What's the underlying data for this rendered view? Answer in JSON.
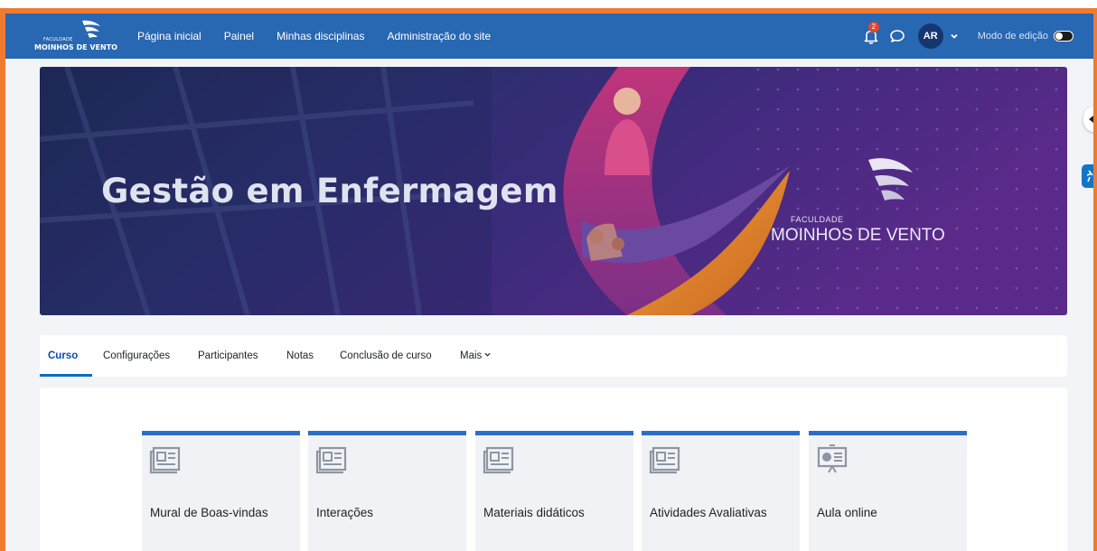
{
  "navbar": {
    "brand_small": "FACULDADE",
    "brand_big": "MOINHOS DE VENTO",
    "links": [
      "Página inicial",
      "Painel",
      "Minhas disciplinas",
      "Administração do site"
    ],
    "notification_count": "2",
    "avatar_initials": "AR",
    "edit_mode_label": "Modo de edição",
    "edit_mode_on": false
  },
  "banner": {
    "title": "Gestão em Enfermagem",
    "logo_small": "FACULDADE",
    "logo_big": "MOINHOS DE VENTO"
  },
  "tabs": [
    {
      "label": "Curso",
      "active": true
    },
    {
      "label": "Configurações",
      "active": false
    },
    {
      "label": "Participantes",
      "active": false
    },
    {
      "label": "Notas",
      "active": false
    },
    {
      "label": "Conclusão de curso",
      "active": false
    },
    {
      "label": "Mais",
      "active": false
    }
  ],
  "sections": [
    {
      "label": "Mural de Boas-vindas",
      "icon": "forum-icon"
    },
    {
      "label": "Interações",
      "icon": "forum-icon"
    },
    {
      "label": "Materiais didáticos",
      "icon": "forum-icon"
    },
    {
      "label": "Atividades Avaliativas",
      "icon": "forum-icon"
    },
    {
      "label": "Aula online",
      "icon": "presentation-icon"
    }
  ],
  "colors": {
    "navbar": "#2867b2",
    "frame": "#ee7b2f",
    "accent": "#0f6cbf",
    "card_border": "#2a6ec9"
  }
}
